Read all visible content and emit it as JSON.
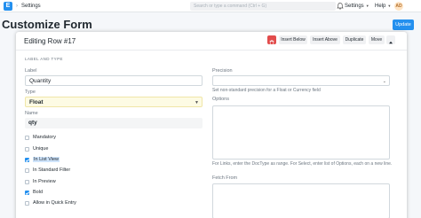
{
  "navbar": {
    "logo_letter": "E",
    "breadcrumb": "Settings",
    "search_placeholder": "Search or type a command (Ctrl + G)",
    "settings_label": "Settings",
    "help_label": "Help",
    "avatar_initials": "AD"
  },
  "page": {
    "title": "Customize Form",
    "update_label": "Update"
  },
  "modal": {
    "title": "Editing Row #17",
    "buttons": {
      "insert_below": "Insert Below",
      "insert_above": "Insert Above",
      "duplicate": "Duplicate",
      "move": "Move"
    },
    "section": "LABEL AND TYPE",
    "label": {
      "label": "Label",
      "value": "Quantity"
    },
    "type": {
      "label": "Type",
      "value": "Float"
    },
    "name": {
      "label": "Name",
      "value": "qty"
    },
    "checkboxes": [
      {
        "label": "Mandatory",
        "checked": false
      },
      {
        "label": "Unique",
        "checked": false
      },
      {
        "label": "In List View",
        "checked": true
      },
      {
        "label": "In Standard Filter",
        "checked": false
      },
      {
        "label": "In Preview",
        "checked": false
      },
      {
        "label": "Bold",
        "checked": true
      },
      {
        "label": "Allow in Quick Entry",
        "checked": false
      }
    ],
    "precision": {
      "label": "Precision",
      "value": "",
      "help": "Set non-standard precision for a Float or Currency field"
    },
    "options": {
      "label": "Options",
      "help": "For Links, enter the DocType as range. For Select, enter list of Options, each on a new line."
    },
    "fetch_from": {
      "label": "Fetch From"
    }
  }
}
